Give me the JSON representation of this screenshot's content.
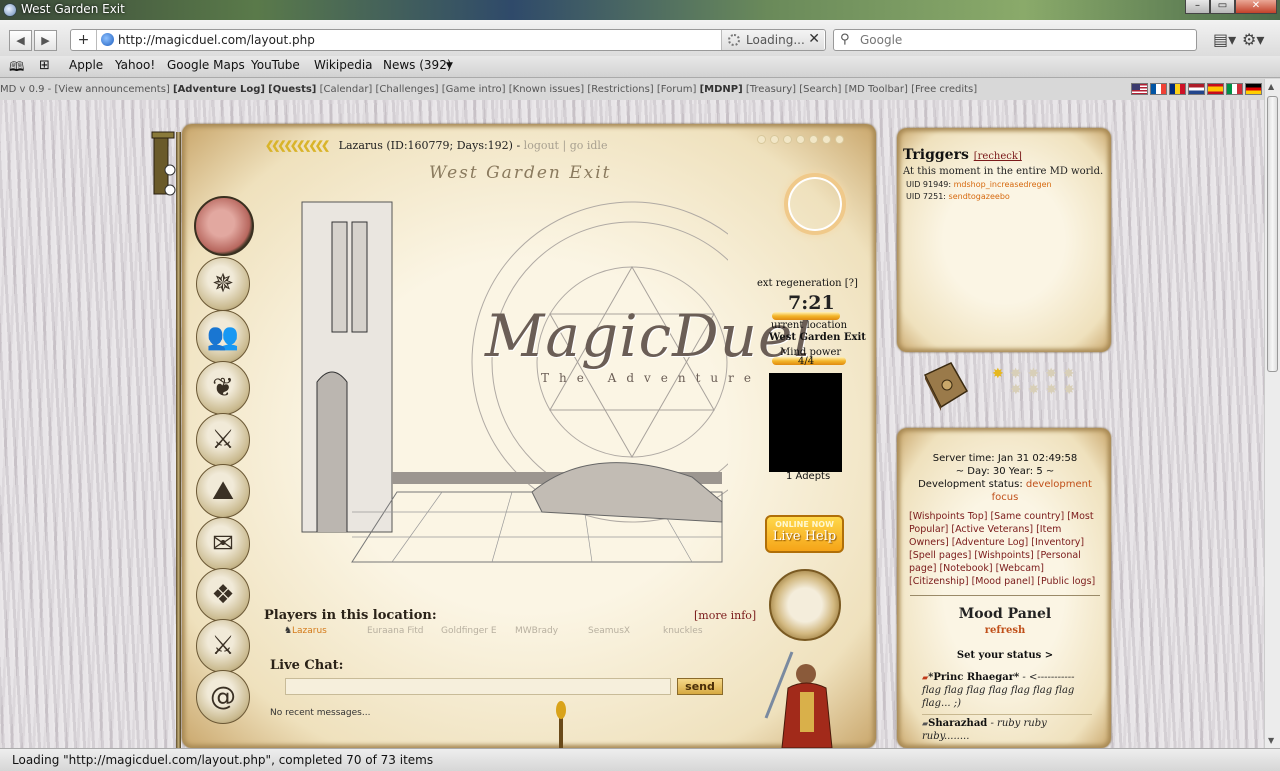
{
  "window": {
    "title": "West Garden Exit"
  },
  "toolbar": {
    "url": "http://magicduel.com/layout.php",
    "loading_label": "Loading...",
    "search_placeholder": "Google"
  },
  "bookmarks": [
    "Apple",
    "Yahoo!",
    "Google Maps",
    "YouTube",
    "Wikipedia",
    "News (392)"
  ],
  "site_menu": {
    "version": "MD v 0.9 -",
    "items": [
      "[View announcements]",
      "[Adventure Log]",
      "[Quests]",
      "[Calendar]",
      "[Challenges]",
      "[Game intro]",
      "[Known issues]",
      "[Restrictions]",
      "[Forum]",
      "[MDNP]",
      "[Treasury]",
      "[Search]",
      "[MD Toolbar]",
      "[Free credits]"
    ]
  },
  "flags": [
    {
      "name": "us-flag",
      "color": "#3c3b6e"
    },
    {
      "name": "fr-flag",
      "color": "#0055a4"
    },
    {
      "name": "ro-flag",
      "color": "#fcd116"
    },
    {
      "name": "nl-flag",
      "color": "#21468b"
    },
    {
      "name": "es-flag",
      "color": "#c60b1e"
    },
    {
      "name": "it-flag",
      "color": "#009246"
    },
    {
      "name": "de-flag",
      "color": "#000000"
    }
  ],
  "player": {
    "info": "Lazarus (ID:160779; Days:192) -",
    "logout": "logout",
    "separator": "|",
    "go_idle": "go idle"
  },
  "location": {
    "title": "West Garden Exit"
  },
  "logo": {
    "title": "MagicDuel",
    "subtitle": "The Adventure"
  },
  "stats": {
    "regen_label": "ext regeneration [?]",
    "regen_value": "7:21",
    "current_location_label": "urrent location",
    "current_location_value": "West Garden Exit",
    "mind_power_label": "Mind power",
    "mind_power_value": "4/4",
    "mind_power_fraction": 1.0,
    "adepts": "1  Adepts"
  },
  "live_help": {
    "line1": "ONLINE NOW",
    "line2": "Live Help"
  },
  "players": {
    "title": "Players in this location:",
    "more_info": "[more info]",
    "list": [
      "Lazarus",
      "Euraana Fitd",
      "Goldfinger E",
      "MWBrady",
      "SeamusX",
      "knuckles"
    ]
  },
  "chat": {
    "title": "Live Chat:",
    "send": "send",
    "empty": "No recent messages..."
  },
  "triggers": {
    "title": "Triggers",
    "recheck": "[recheck]",
    "subtitle": "At this moment in the entire MD world.",
    "items": [
      {
        "uid": "UID 91949:",
        "name": "mdshop_increasedregen"
      },
      {
        "uid": "UID 7251:",
        "name": "sendtogazeebo"
      }
    ]
  },
  "server": {
    "time": "Server time: Jan 31 02:49:58",
    "day": "~ Day: 30 Year: 5 ~",
    "dev_label": "Development status:",
    "dev_value": "development focus"
  },
  "links": [
    "[Wishpoints Top]",
    "[Same country]",
    "[Most Popular]",
    "[Active Veterans]",
    "[Item Owners]",
    "[Adventure Log]",
    "[Inventory]",
    "[Spell pages]",
    "[Wishpoints]",
    "[Personal page]",
    "[Notebook]",
    "[Webcam]",
    "[Citizenship]",
    "[Mood panel]",
    "[Public logs]"
  ],
  "mood": {
    "title": "Mood Panel",
    "refresh": "refresh",
    "set_status": "Set your status >",
    "entries": [
      {
        "name": "*Princ Rhaegar*",
        "text": " - <----------- flag flag flag flag flag flag flag flag... ;)"
      },
      {
        "name": "Sharazhad",
        "text": " - ruby ruby ruby........"
      }
    ]
  },
  "statusbar": {
    "text": "Loading \"http://magicduel.com/layout.php\", completed 70 of 73 items"
  }
}
